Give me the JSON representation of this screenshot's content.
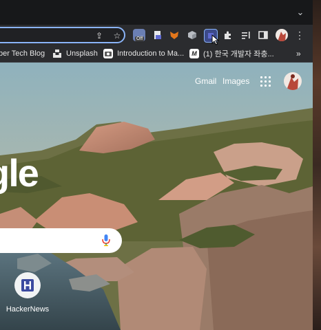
{
  "toolbar": {
    "extension_badge": "Off"
  },
  "bookmarks": [
    {
      "label": "ber Tech Blog",
      "icon": "bookmark-label-icon"
    },
    {
      "label": "Unsplash",
      "icon": "unsplash-icon"
    },
    {
      "label": "Introduction to Ma...",
      "icon": "bookmark-site-icon"
    },
    {
      "label": "(1) 한국 개발자 좌충...",
      "icon": "m-site-icon"
    }
  ],
  "bookmarks_overflow": "»",
  "google_topnav": {
    "gmail": "Gmail",
    "images": "Images"
  },
  "logo_partial": "gle",
  "shortcuts": [
    {
      "label": "HackerNews",
      "icon_letter": "H"
    }
  ],
  "colors": {
    "omnibox_focus": "#8ab4f8",
    "toolbar_bg": "#2b2c2f",
    "tabstrip_bg": "#17181a",
    "hn_icon": "#3b4aa0"
  }
}
